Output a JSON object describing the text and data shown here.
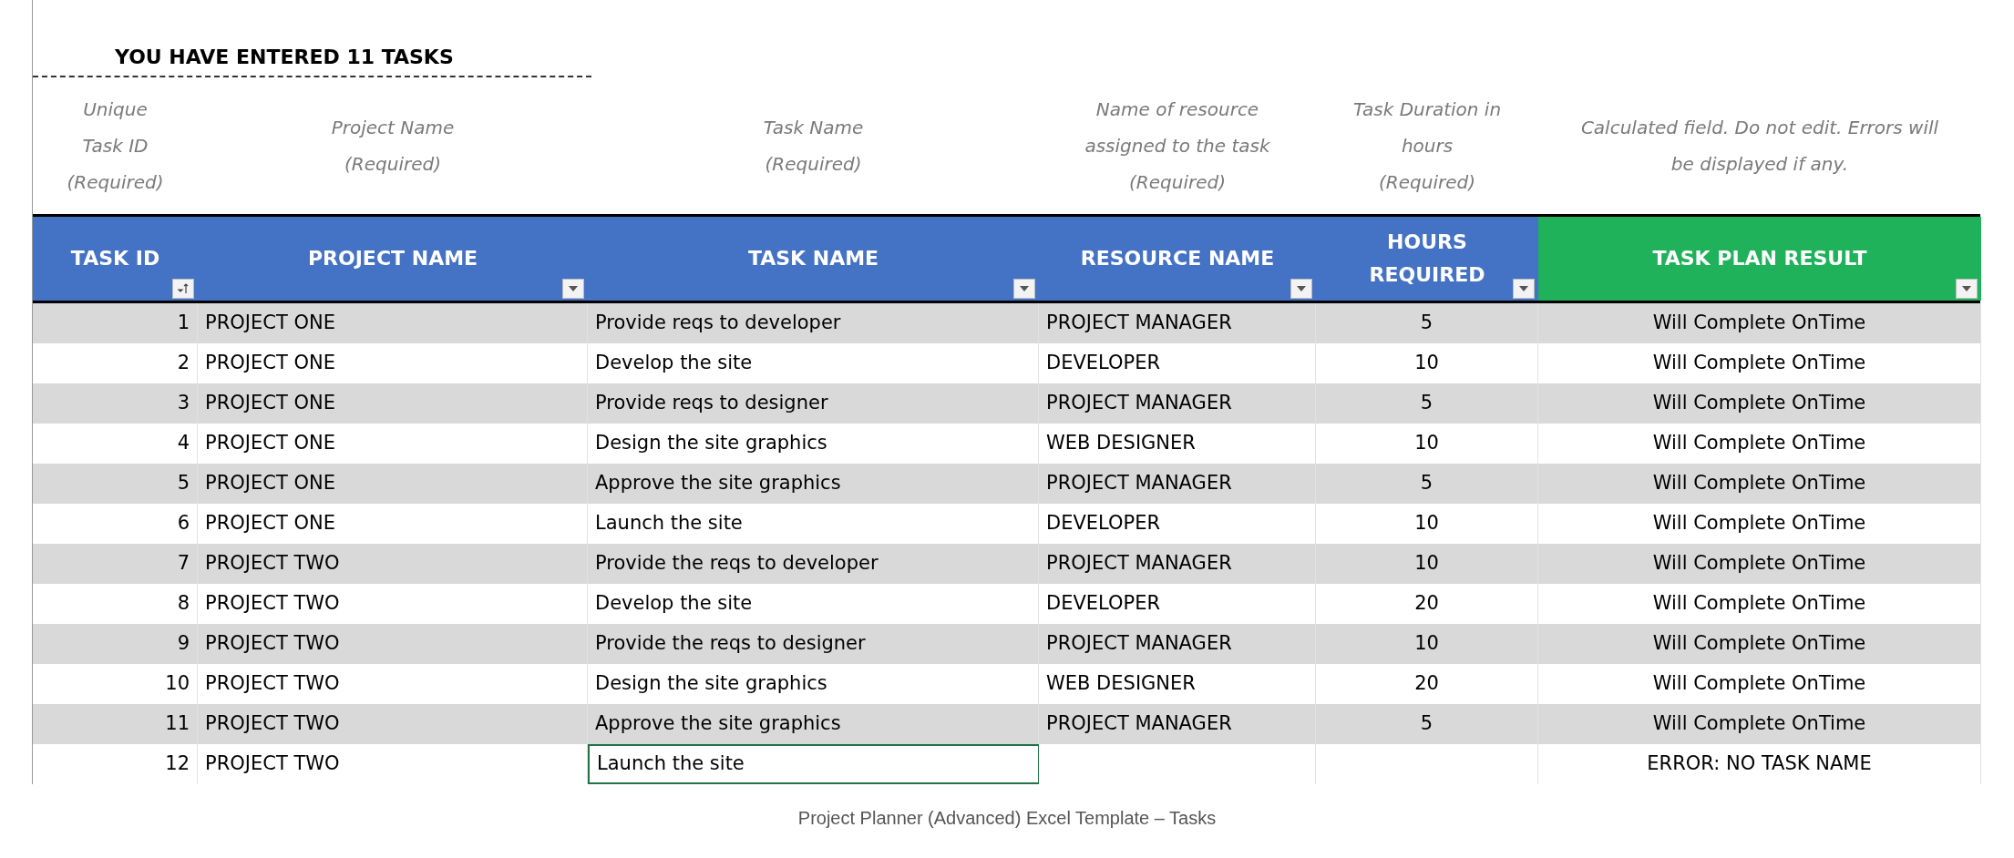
{
  "summary": "YOU HAVE ENTERED 11 TASKS",
  "hints": [
    "Unique Task ID (Required)",
    "Project Name (Required)",
    "Task Name (Required)",
    "Name of resource assigned to the task (Required)",
    "Task Duration in hours (Required)",
    "Calculated field. Do not edit. Errors will be displayed if any."
  ],
  "columns": [
    {
      "label": "TASK ID",
      "color": "#4472c4",
      "kind": "sort"
    },
    {
      "label": "PROJECT NAME",
      "color": "#4472c4",
      "kind": "dropdown"
    },
    {
      "label": "TASK NAME",
      "color": "#4472c4",
      "kind": "dropdown"
    },
    {
      "label": "RESOURCE NAME",
      "color": "#4472c4",
      "kind": "dropdown"
    },
    {
      "label": "HOURS REQUIRED",
      "color": "#4472c4",
      "kind": "dropdown"
    },
    {
      "label": "TASK PLAN RESULT",
      "color": "#1fb25a",
      "kind": "dropdown"
    }
  ],
  "rows": [
    {
      "id": "1",
      "project": "PROJECT ONE",
      "task": "Provide reqs to developer",
      "resource": "PROJECT MANAGER",
      "hours": "5",
      "result": "Will Complete OnTime",
      "selected": false
    },
    {
      "id": "2",
      "project": "PROJECT ONE",
      "task": "Develop the site",
      "resource": "DEVELOPER",
      "hours": "10",
      "result": "Will Complete OnTime",
      "selected": false
    },
    {
      "id": "3",
      "project": "PROJECT ONE",
      "task": "Provide reqs to designer",
      "resource": "PROJECT MANAGER",
      "hours": "5",
      "result": "Will Complete OnTime",
      "selected": false
    },
    {
      "id": "4",
      "project": "PROJECT ONE",
      "task": "Design the site graphics",
      "resource": "WEB DESIGNER",
      "hours": "10",
      "result": "Will Complete OnTime",
      "selected": false
    },
    {
      "id": "5",
      "project": "PROJECT ONE",
      "task": "Approve the site graphics",
      "resource": "PROJECT MANAGER",
      "hours": "5",
      "result": "Will Complete OnTime",
      "selected": false
    },
    {
      "id": "6",
      "project": "PROJECT ONE",
      "task": "Launch the site",
      "resource": "DEVELOPER",
      "hours": "10",
      "result": "Will Complete OnTime",
      "selected": false
    },
    {
      "id": "7",
      "project": "PROJECT TWO",
      "task": "Provide the reqs to developer",
      "resource": "PROJECT MANAGER",
      "hours": "10",
      "result": "Will Complete OnTime",
      "selected": false
    },
    {
      "id": "8",
      "project": "PROJECT TWO",
      "task": "Develop the site",
      "resource": "DEVELOPER",
      "hours": "20",
      "result": "Will Complete OnTime",
      "selected": false
    },
    {
      "id": "9",
      "project": "PROJECT TWO",
      "task": "Provide the reqs to designer",
      "resource": "PROJECT MANAGER",
      "hours": "10",
      "result": "Will Complete OnTime",
      "selected": false
    },
    {
      "id": "10",
      "project": "PROJECT TWO",
      "task": "Design the site graphics",
      "resource": "WEB DESIGNER",
      "hours": "20",
      "result": "Will Complete OnTime",
      "selected": false
    },
    {
      "id": "11",
      "project": "PROJECT TWO",
      "task": "Approve the site graphics",
      "resource": "PROJECT MANAGER",
      "hours": "5",
      "result": "Will Complete OnTime",
      "selected": false
    },
    {
      "id": "12",
      "project": "PROJECT TWO",
      "task": "Launch the site",
      "result": "ERROR: NO TASK NAME",
      "selected": true
    }
  ],
  "caption": "Project Planner (Advanced) Excel Template – Tasks"
}
